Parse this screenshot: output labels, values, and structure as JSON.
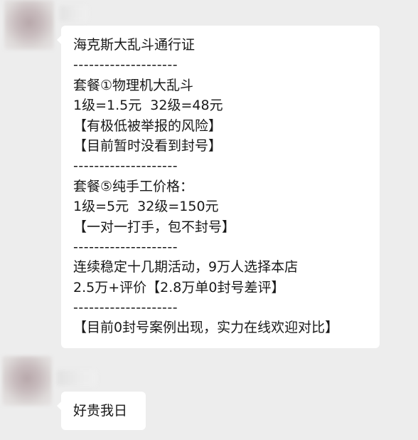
{
  "messages": [
    {
      "sender": "other",
      "lines": [
        "海克斯大乱斗通行证",
        "--------------------",
        "套餐①物理机大乱斗",
        "1级=1.5元  32级=48元",
        "【有极低被举报的风险】",
        "【目前暂时没看到封号】",
        "--------------------",
        "套餐⑤纯手工价格：",
        "1级=5元  32级=150元",
        "【一对一打手，包不封号】",
        "--------------------",
        "连续稳定十几期活动，9万人选择本店",
        "2.5万+评价【2.8万单0封号差评】",
        "--------------------",
        "【目前0封号案例出现，实力在线欢迎对比】"
      ]
    },
    {
      "sender": "other",
      "lines": [
        "好贵我日"
      ]
    }
  ]
}
